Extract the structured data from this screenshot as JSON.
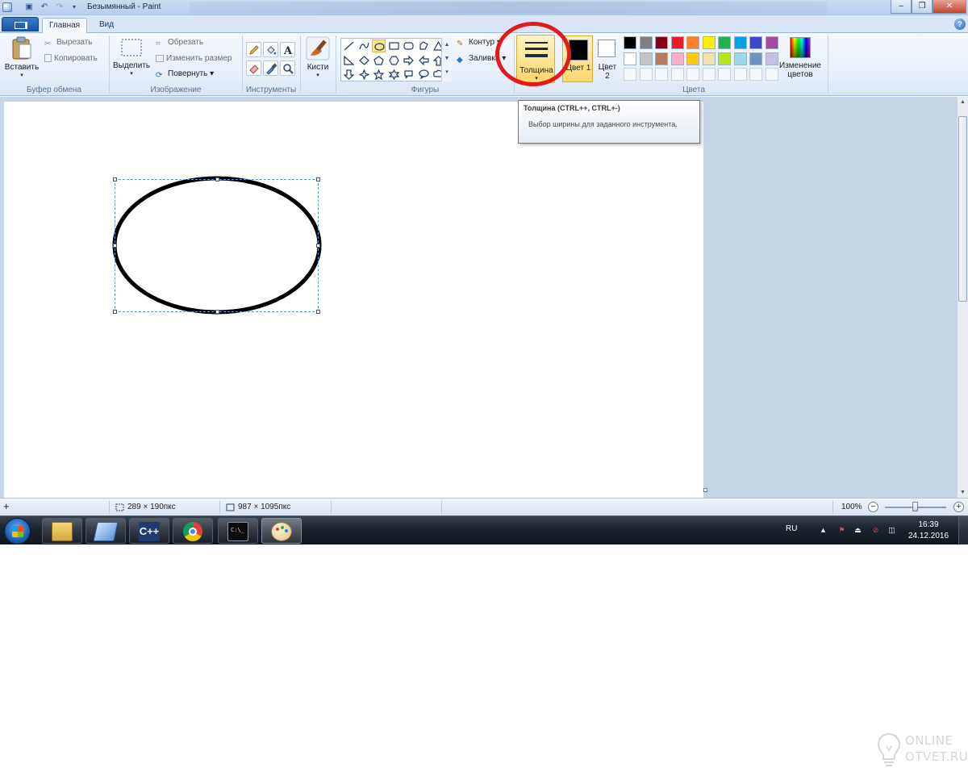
{
  "window": {
    "title": "Безымянный - Paint"
  },
  "ribbon_tabs": [
    {
      "label": "Главная",
      "active": true
    },
    {
      "label": "Вид",
      "active": false
    }
  ],
  "clipboard": {
    "paste_label": "Вставить",
    "cut_label": "Вырезать",
    "copy_label": "Копировать",
    "group_label": "Буфер обмена"
  },
  "image": {
    "select_label": "Выделить",
    "crop_label": "Обрезать",
    "resize_label": "Изменить размер",
    "rotate_label": "Повернуть",
    "group_label": "Изображение"
  },
  "tools": {
    "group_label": "Инструменты",
    "items": [
      "pencil-icon",
      "fill-icon",
      "text-icon",
      "eraser-icon",
      "color-picker-icon",
      "magnifier-icon"
    ]
  },
  "brushes": {
    "label": "Кисти"
  },
  "shapes": {
    "group_label": "Фигуры",
    "outline_label": "Контур",
    "fill_label": "Заливка",
    "selected_shape": "oval"
  },
  "thickness": {
    "label": "Толщина"
  },
  "colors": {
    "group_label": "Цвета",
    "color1_label": "Цвет 1",
    "color2_label": "Цвет 2",
    "color1_value": "#000000",
    "color2_value": "#ffffff",
    "edit_colors_label": "Изменение цветов",
    "palette": [
      "#000000",
      "#7f7f7f",
      "#880015",
      "#ed1c24",
      "#ff7f27",
      "#fff200",
      "#22b14c",
      "#00a2e8",
      "#3f48cc",
      "#a349a4",
      "#ffffff",
      "#c3c3c3",
      "#b97a57",
      "#ffaec9",
      "#ffc90e",
      "#efe4b0",
      "#b5e61d",
      "#99d9ea",
      "#7092be",
      "#c8bfe7"
    ]
  },
  "tooltip": {
    "title": "Толщина (CTRL++, CTRL+-)",
    "description": "Выбор ширины для заданного инструмента."
  },
  "statusbar": {
    "selection_size": "289 × 190пкс",
    "canvas_size": "987 × 1095пкс",
    "zoom": "100%",
    "zoom_fraction": 0.5
  },
  "taskbar": {
    "apps": [
      "explorer-icon",
      "desktop-switch-icon",
      "cpp-ide-icon",
      "chrome-icon",
      "console-icon",
      "paint-icon"
    ],
    "language": "RU",
    "time": "16:39",
    "date": "24.12.2016"
  },
  "watermark": {
    "line1": "ONLINE",
    "line2": "OTVET.RU"
  }
}
